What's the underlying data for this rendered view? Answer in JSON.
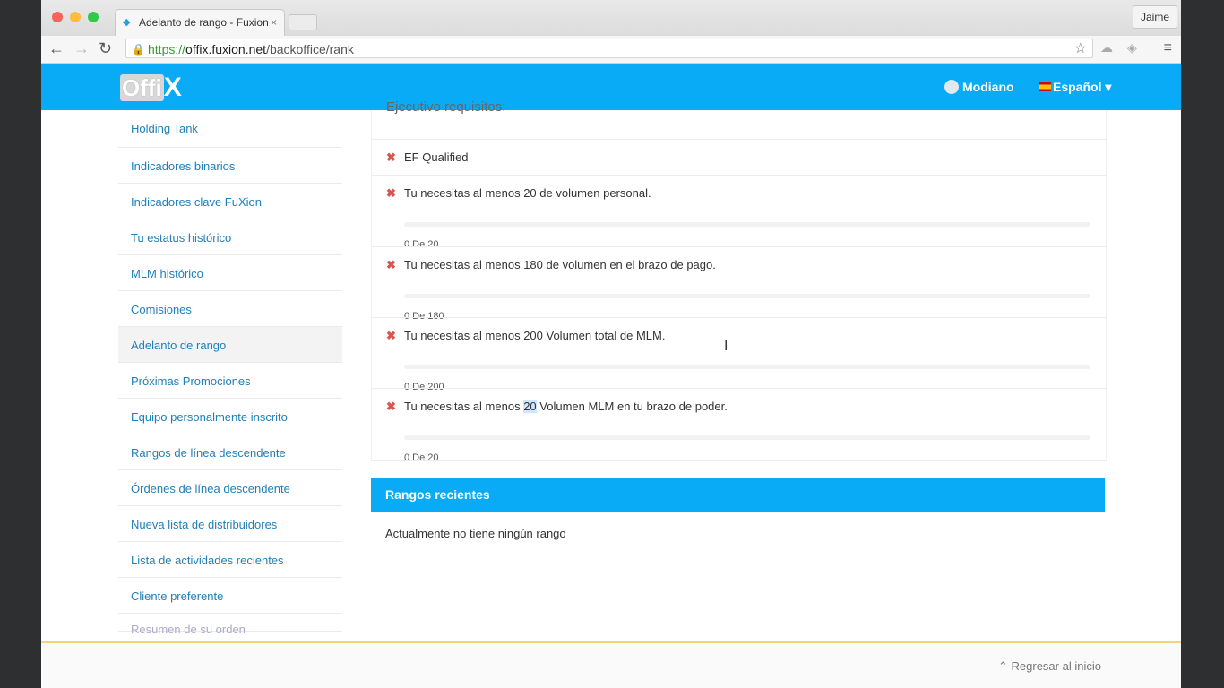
{
  "browser": {
    "tab_title": "Adelanto de rango - Fuxion",
    "tab_close": "×",
    "profile": "Jaime",
    "url_scheme": "https://",
    "url_host": "offix.fuxion.net",
    "url_path": "/backoffice/rank"
  },
  "header": {
    "logo_left": "Offi",
    "logo_right": "X",
    "user_name": "Modiano",
    "language": "Español ▾"
  },
  "sidebar": {
    "items": [
      {
        "label": "Holding Tank"
      },
      {
        "label": "Indicadores binarios"
      },
      {
        "label": "Indicadores clave FuXion"
      },
      {
        "label": "Tu estatus histórico"
      },
      {
        "label": "MLM histórico"
      },
      {
        "label": "Comisiones"
      },
      {
        "label": "Adelanto de rango"
      },
      {
        "label": "Próximas Promociones"
      },
      {
        "label": "Equipo personalmente inscrito"
      },
      {
        "label": "Rangos de línea descendente"
      },
      {
        "label": "Órdenes de línea descendente"
      },
      {
        "label": "Nueva lista de distribuidores"
      },
      {
        "label": "Lista de actividades recientes"
      },
      {
        "label": "Cliente preferente"
      },
      {
        "label": "Resumen de su orden"
      }
    ]
  },
  "requirements": {
    "title": "Ejecutivo requisitos:",
    "items": [
      {
        "text": "EF Qualified",
        "progress": null,
        "count": ""
      },
      {
        "text": "Tu necesitas al menos 20 de volumen personal.",
        "progress": 0,
        "count": "0 De 20"
      },
      {
        "text": "Tu necesitas al menos 180 de volumen en el brazo de pago.",
        "progress": 0,
        "count": "0 De 180"
      },
      {
        "text": "Tu necesitas al menos 200 Volumen total de MLM.",
        "progress": 0,
        "count": "0 De 200"
      },
      {
        "text_before": "Tu necesitas al menos ",
        "text_highlight": "20",
        "text_after": " Volumen MLM en tu brazo de poder.",
        "progress": 0,
        "count": "0 De 20"
      }
    ]
  },
  "recent_ranks": {
    "title": "Rangos recientes",
    "empty": "Actualmente no tiene ningún rango"
  },
  "footer": {
    "back_to_top": "Regresar al inicio"
  },
  "colors": {
    "brand": "#0aabf6",
    "error": "#d9534f"
  }
}
